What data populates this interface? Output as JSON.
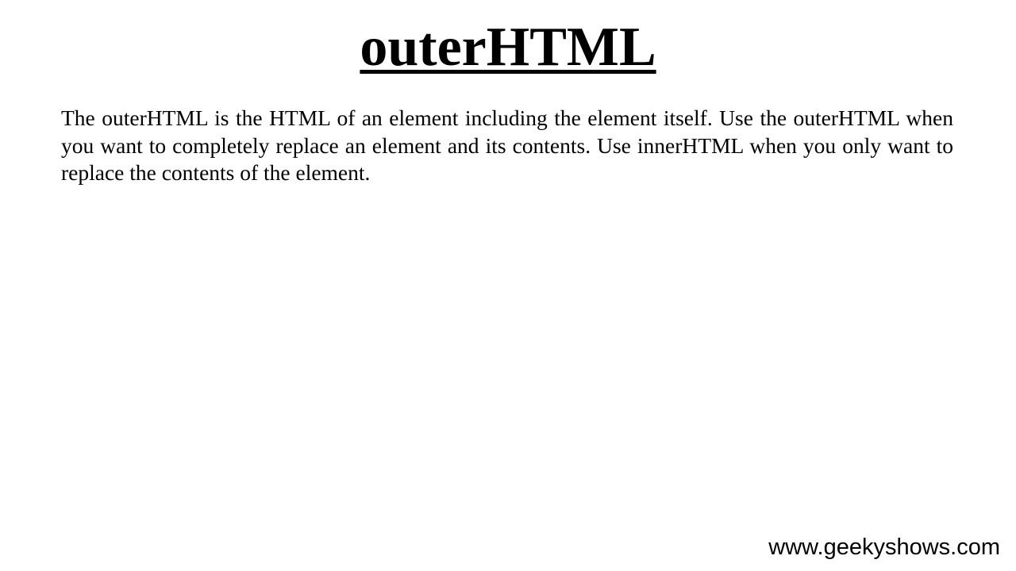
{
  "slide": {
    "title": "outerHTML",
    "body": "The outerHTML is the HTML of an element including the element itself. Use the outerHTML when you want to completely replace an element and its contents. Use innerHTML when you only want to replace the contents of the element.",
    "footer_url": "www.geekyshows.com"
  }
}
